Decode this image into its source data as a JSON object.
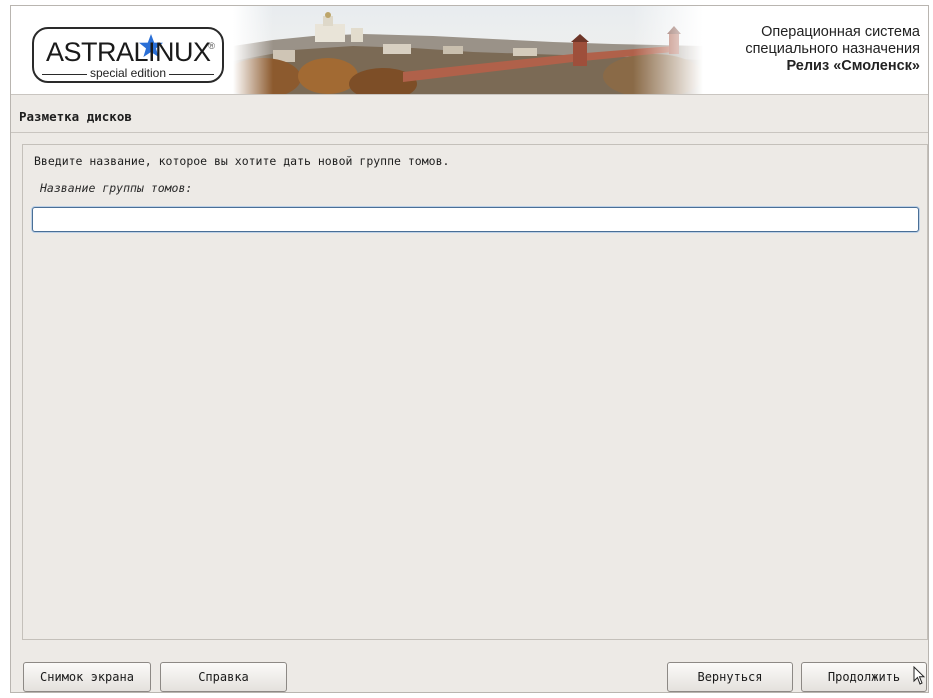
{
  "header": {
    "logo_text": "ASTRALINUX",
    "logo_registered": "®",
    "logo_subtitle": "special edition",
    "title_line1": "Операционная система",
    "title_line2": "специального назначения",
    "release": "Релиз «Смоленск»",
    "photo": "smolensk-kremlin-panorama"
  },
  "page": {
    "section_title": "Разметка дисков",
    "prompt": "Введите название, которое вы хотите дать новой группе томов.",
    "field_label": "Название группы томов:",
    "input_value": "",
    "input_placeholder": ""
  },
  "buttons": {
    "screenshot": "Снимок экрана",
    "help": "Справка",
    "back": "Вернуться",
    "continue": "Продолжить"
  },
  "colors": {
    "background": "#edeae6",
    "accent_star": "#2a6fd6",
    "input_border": "#4a6f96"
  },
  "icons": {
    "logo_star": "star-icon",
    "pointer": "mouse-cursor-icon"
  }
}
